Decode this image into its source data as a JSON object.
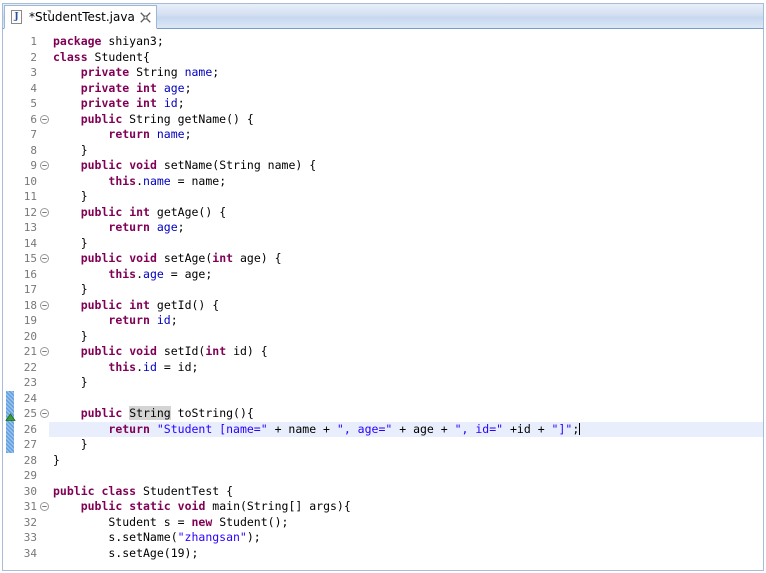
{
  "window": {
    "kind": "eclipse-java-editor"
  },
  "tab": {
    "label": "*StudentTest.java",
    "icon": "java-file-icon",
    "icon_letter": "J",
    "close_icon": "close-tab-icon",
    "dirty": true
  },
  "editor": {
    "current_line": 26,
    "caret_column_end": true,
    "occurrence_highlight": "String",
    "change_bar_lines": [
      24,
      25,
      26,
      27
    ],
    "quickfix_marker_line": 25,
    "colors": {
      "keyword": "#7f0055",
      "string": "#2a00ff",
      "field": "#0000c0",
      "plain": "#000000",
      "line_number": "#787878",
      "current_line_bg": "#e8eefb",
      "occurrence_bg": "#d4d4d4",
      "change_bar": "#62a0e0",
      "tab_bar_bg": "#d3e0f2",
      "editor_bg": "#ffffff"
    }
  },
  "code_lines": [
    {
      "n": 1,
      "fold": false,
      "text": "package shiyan3;",
      "tokens": [
        {
          "t": "package",
          "c": "kw"
        },
        {
          "t": " shiyan3;",
          "c": "plain"
        }
      ]
    },
    {
      "n": 2,
      "fold": false,
      "text": "class Student{",
      "tokens": [
        {
          "t": "class",
          "c": "kw"
        },
        {
          "t": " Student{",
          "c": "plain"
        }
      ]
    },
    {
      "n": 3,
      "fold": false,
      "text": "    private String name;",
      "tokens": [
        {
          "t": "    ",
          "c": "plain"
        },
        {
          "t": "private",
          "c": "kw"
        },
        {
          "t": " String ",
          "c": "plain"
        },
        {
          "t": "name",
          "c": "fld"
        },
        {
          "t": ";",
          "c": "plain"
        }
      ]
    },
    {
      "n": 4,
      "fold": false,
      "text": "    private int age;",
      "tokens": [
        {
          "t": "    ",
          "c": "plain"
        },
        {
          "t": "private",
          "c": "kw"
        },
        {
          "t": " ",
          "c": "plain"
        },
        {
          "t": "int",
          "c": "kw"
        },
        {
          "t": " ",
          "c": "plain"
        },
        {
          "t": "age",
          "c": "fld"
        },
        {
          "t": ";",
          "c": "plain"
        }
      ]
    },
    {
      "n": 5,
      "fold": false,
      "text": "    private int id;",
      "tokens": [
        {
          "t": "    ",
          "c": "plain"
        },
        {
          "t": "private",
          "c": "kw"
        },
        {
          "t": " ",
          "c": "plain"
        },
        {
          "t": "int",
          "c": "kw"
        },
        {
          "t": " ",
          "c": "plain"
        },
        {
          "t": "id",
          "c": "fld"
        },
        {
          "t": ";",
          "c": "plain"
        }
      ]
    },
    {
      "n": 6,
      "fold": true,
      "text": "    public String getName() {",
      "tokens": [
        {
          "t": "    ",
          "c": "plain"
        },
        {
          "t": "public",
          "c": "kw"
        },
        {
          "t": " String getName() {",
          "c": "plain"
        }
      ]
    },
    {
      "n": 7,
      "fold": false,
      "text": "        return name;",
      "tokens": [
        {
          "t": "        ",
          "c": "plain"
        },
        {
          "t": "return",
          "c": "kw"
        },
        {
          "t": " ",
          "c": "plain"
        },
        {
          "t": "name",
          "c": "fld"
        },
        {
          "t": ";",
          "c": "plain"
        }
      ]
    },
    {
      "n": 8,
      "fold": false,
      "text": "    }",
      "tokens": [
        {
          "t": "    }",
          "c": "plain"
        }
      ]
    },
    {
      "n": 9,
      "fold": true,
      "text": "    public void setName(String name) {",
      "tokens": [
        {
          "t": "    ",
          "c": "plain"
        },
        {
          "t": "public",
          "c": "kw"
        },
        {
          "t": " ",
          "c": "plain"
        },
        {
          "t": "void",
          "c": "kw"
        },
        {
          "t": " setName(String name) {",
          "c": "plain"
        }
      ]
    },
    {
      "n": 10,
      "fold": false,
      "text": "        this.name = name;",
      "tokens": [
        {
          "t": "        ",
          "c": "plain"
        },
        {
          "t": "this",
          "c": "kw"
        },
        {
          "t": ".",
          "c": "plain"
        },
        {
          "t": "name",
          "c": "fld"
        },
        {
          "t": " = name;",
          "c": "plain"
        }
      ]
    },
    {
      "n": 11,
      "fold": false,
      "text": "    }",
      "tokens": [
        {
          "t": "    }",
          "c": "plain"
        }
      ]
    },
    {
      "n": 12,
      "fold": true,
      "text": "    public int getAge() {",
      "tokens": [
        {
          "t": "    ",
          "c": "plain"
        },
        {
          "t": "public",
          "c": "kw"
        },
        {
          "t": " ",
          "c": "plain"
        },
        {
          "t": "int",
          "c": "kw"
        },
        {
          "t": " getAge() {",
          "c": "plain"
        }
      ]
    },
    {
      "n": 13,
      "fold": false,
      "text": "        return age;",
      "tokens": [
        {
          "t": "        ",
          "c": "plain"
        },
        {
          "t": "return",
          "c": "kw"
        },
        {
          "t": " ",
          "c": "plain"
        },
        {
          "t": "age",
          "c": "fld"
        },
        {
          "t": ";",
          "c": "plain"
        }
      ]
    },
    {
      "n": 14,
      "fold": false,
      "text": "    }",
      "tokens": [
        {
          "t": "    }",
          "c": "plain"
        }
      ]
    },
    {
      "n": 15,
      "fold": true,
      "text": "    public void setAge(int age) {",
      "tokens": [
        {
          "t": "    ",
          "c": "plain"
        },
        {
          "t": "public",
          "c": "kw"
        },
        {
          "t": " ",
          "c": "plain"
        },
        {
          "t": "void",
          "c": "kw"
        },
        {
          "t": " setAge(",
          "c": "plain"
        },
        {
          "t": "int",
          "c": "kw"
        },
        {
          "t": " age) {",
          "c": "plain"
        }
      ]
    },
    {
      "n": 16,
      "fold": false,
      "text": "        this.age = age;",
      "tokens": [
        {
          "t": "        ",
          "c": "plain"
        },
        {
          "t": "this",
          "c": "kw"
        },
        {
          "t": ".",
          "c": "plain"
        },
        {
          "t": "age",
          "c": "fld"
        },
        {
          "t": " = age;",
          "c": "plain"
        }
      ]
    },
    {
      "n": 17,
      "fold": false,
      "text": "    }",
      "tokens": [
        {
          "t": "    }",
          "c": "plain"
        }
      ]
    },
    {
      "n": 18,
      "fold": true,
      "text": "    public int getId() {",
      "tokens": [
        {
          "t": "    ",
          "c": "plain"
        },
        {
          "t": "public",
          "c": "kw"
        },
        {
          "t": " ",
          "c": "plain"
        },
        {
          "t": "int",
          "c": "kw"
        },
        {
          "t": " getId() {",
          "c": "plain"
        }
      ]
    },
    {
      "n": 19,
      "fold": false,
      "text": "        return id;",
      "tokens": [
        {
          "t": "        ",
          "c": "plain"
        },
        {
          "t": "return",
          "c": "kw"
        },
        {
          "t": " ",
          "c": "plain"
        },
        {
          "t": "id",
          "c": "fld"
        },
        {
          "t": ";",
          "c": "plain"
        }
      ]
    },
    {
      "n": 20,
      "fold": false,
      "text": "    }",
      "tokens": [
        {
          "t": "    }",
          "c": "plain"
        }
      ]
    },
    {
      "n": 21,
      "fold": true,
      "text": "    public void setId(int id) {",
      "tokens": [
        {
          "t": "    ",
          "c": "plain"
        },
        {
          "t": "public",
          "c": "kw"
        },
        {
          "t": " ",
          "c": "plain"
        },
        {
          "t": "void",
          "c": "kw"
        },
        {
          "t": " setId(",
          "c": "plain"
        },
        {
          "t": "int",
          "c": "kw"
        },
        {
          "t": " id) {",
          "c": "plain"
        }
      ]
    },
    {
      "n": 22,
      "fold": false,
      "text": "        this.id = id;",
      "tokens": [
        {
          "t": "        ",
          "c": "plain"
        },
        {
          "t": "this",
          "c": "kw"
        },
        {
          "t": ".",
          "c": "plain"
        },
        {
          "t": "id",
          "c": "fld"
        },
        {
          "t": " = id;",
          "c": "plain"
        }
      ]
    },
    {
      "n": 23,
      "fold": false,
      "text": "    }",
      "tokens": [
        {
          "t": "    }",
          "c": "plain"
        }
      ]
    },
    {
      "n": 24,
      "fold": false,
      "text": "",
      "tokens": []
    },
    {
      "n": 25,
      "fold": true,
      "text": "    public String toString(){",
      "tokens": [
        {
          "t": "    ",
          "c": "plain"
        },
        {
          "t": "public",
          "c": "kw"
        },
        {
          "t": " ",
          "c": "plain"
        },
        {
          "t": "String",
          "c": "occ"
        },
        {
          "t": " toString(){",
          "c": "plain"
        }
      ]
    },
    {
      "n": 26,
      "fold": false,
      "current": true,
      "text": "        return \"Student [name=\" + name + \", age=\" + age + \", id=\" +id + \"]\";",
      "tokens": [
        {
          "t": "        ",
          "c": "plain"
        },
        {
          "t": "return",
          "c": "kw"
        },
        {
          "t": " ",
          "c": "plain"
        },
        {
          "t": "\"Student [name=\"",
          "c": "str"
        },
        {
          "t": " + name + ",
          "c": "plain"
        },
        {
          "t": "\", age=\"",
          "c": "str"
        },
        {
          "t": " + age + ",
          "c": "plain"
        },
        {
          "t": "\", id=\"",
          "c": "str"
        },
        {
          "t": " +id + ",
          "c": "plain"
        },
        {
          "t": "\"]\"",
          "c": "str"
        },
        {
          "t": ";",
          "c": "plain"
        }
      ]
    },
    {
      "n": 27,
      "fold": false,
      "text": "    }",
      "tokens": [
        {
          "t": "    }",
          "c": "plain"
        }
      ]
    },
    {
      "n": 28,
      "fold": false,
      "text": "}",
      "tokens": [
        {
          "t": "}",
          "c": "plain"
        }
      ]
    },
    {
      "n": 29,
      "fold": false,
      "text": "",
      "tokens": []
    },
    {
      "n": 30,
      "fold": false,
      "text": "public class StudentTest {",
      "tokens": [
        {
          "t": "public",
          "c": "kw"
        },
        {
          "t": " ",
          "c": "plain"
        },
        {
          "t": "class",
          "c": "kw"
        },
        {
          "t": " StudentTest {",
          "c": "plain"
        }
      ]
    },
    {
      "n": 31,
      "fold": true,
      "text": "    public static void main(String[] args){",
      "tokens": [
        {
          "t": "    ",
          "c": "plain"
        },
        {
          "t": "public",
          "c": "kw"
        },
        {
          "t": " ",
          "c": "plain"
        },
        {
          "t": "static",
          "c": "kw"
        },
        {
          "t": " ",
          "c": "plain"
        },
        {
          "t": "void",
          "c": "kw"
        },
        {
          "t": " main(String[] args){",
          "c": "plain"
        }
      ]
    },
    {
      "n": 32,
      "fold": false,
      "text": "        Student s = new Student();",
      "tokens": [
        {
          "t": "        Student s = ",
          "c": "plain"
        },
        {
          "t": "new",
          "c": "kw"
        },
        {
          "t": " Student();",
          "c": "plain"
        }
      ]
    },
    {
      "n": 33,
      "fold": false,
      "text": "        s.setName(\"zhangsan\");",
      "tokens": [
        {
          "t": "        s.setName(",
          "c": "plain"
        },
        {
          "t": "\"zhangsan\"",
          "c": "str"
        },
        {
          "t": ");",
          "c": "plain"
        }
      ]
    },
    {
      "n": 34,
      "fold": false,
      "text": "        s.setAge(19);",
      "tokens": [
        {
          "t": "        s.setAge(19);",
          "c": "plain"
        }
      ]
    }
  ]
}
